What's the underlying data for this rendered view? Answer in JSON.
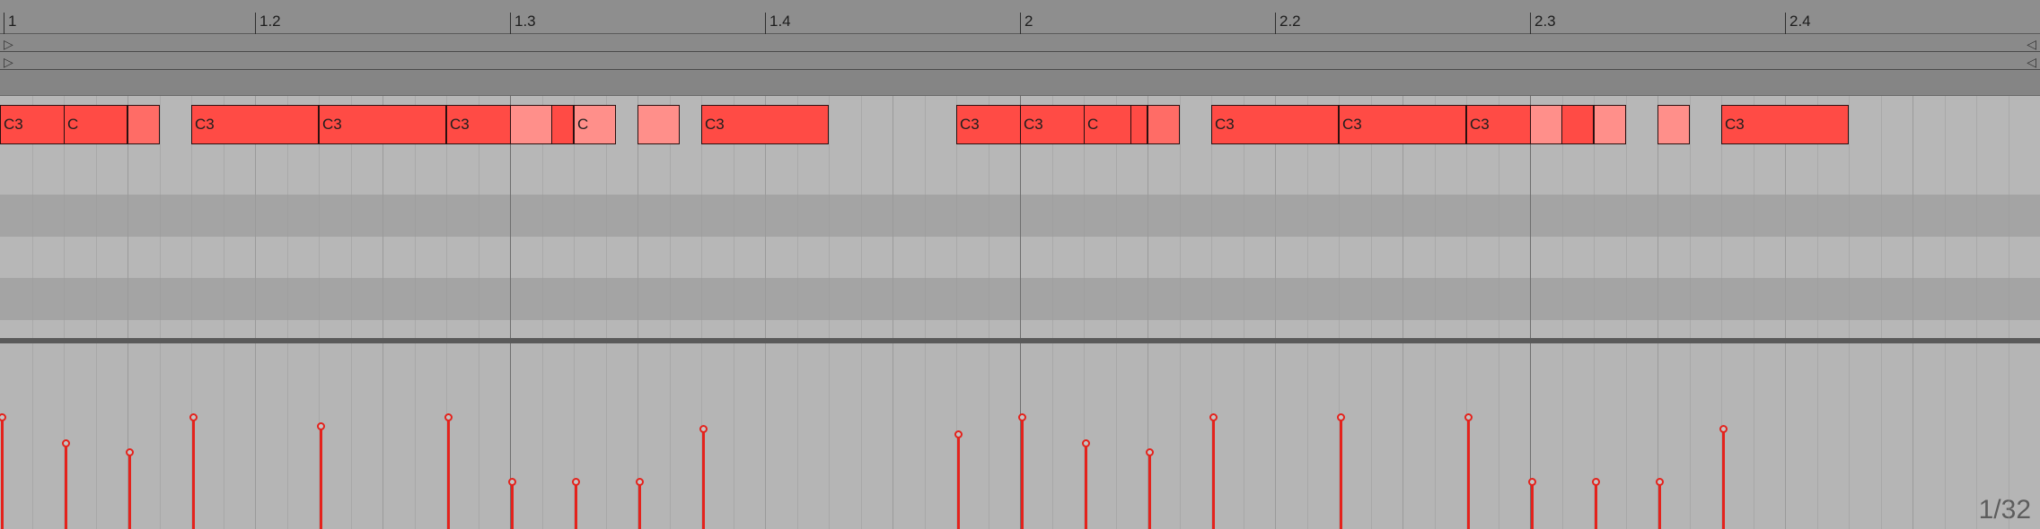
{
  "ruler": {
    "start_beat": 1.0,
    "end_beat": 3.0,
    "markers": [
      {
        "label": "1",
        "beat": 1.0
      },
      {
        "label": "1.2",
        "beat": 1.25
      },
      {
        "label": "1.3",
        "beat": 1.5
      },
      {
        "label": "1.4",
        "beat": 1.75
      },
      {
        "label": "2",
        "beat": 2.0
      },
      {
        "label": "2.2",
        "beat": 2.25
      },
      {
        "label": "2.3",
        "beat": 2.5
      },
      {
        "label": "2.4",
        "beat": 2.75
      }
    ]
  },
  "fold_lanes": [
    {
      "left_glyph": "▷",
      "right_glyph": "◁"
    },
    {
      "left_glyph": "▷",
      "right_glyph": "◁"
    }
  ],
  "notes": [
    {
      "label": "C3",
      "start": 0,
      "length": 2,
      "velocity": 0.78
    },
    {
      "label": "C",
      "start": 2,
      "length": 1,
      "velocity": 0.6
    },
    {
      "label": "",
      "start": 4,
      "length": 0.5,
      "velocity": 0.54
    },
    {
      "label": "C3",
      "start": 6,
      "length": 2,
      "velocity": 0.78
    },
    {
      "label": "C3",
      "start": 10,
      "length": 2,
      "velocity": 0.72
    },
    {
      "label": "C3",
      "start": 14,
      "length": 2,
      "velocity": 0.78
    },
    {
      "label": "",
      "start": 16,
      "length": 0.66,
      "velocity": 0.33
    },
    {
      "label": "C",
      "start": 18,
      "length": 0.66,
      "velocity": 0.33
    },
    {
      "label": "",
      "start": 20,
      "length": 0.66,
      "velocity": 0.33
    },
    {
      "label": "C3",
      "start": 22,
      "length": 2,
      "velocity": 0.7
    },
    {
      "label": "C3",
      "start": 30,
      "length": 2,
      "velocity": 0.66
    },
    {
      "label": "C3",
      "start": 32,
      "length": 2,
      "velocity": 0.78
    },
    {
      "label": "C",
      "start": 34,
      "length": 0.75,
      "velocity": 0.6
    },
    {
      "label": "",
      "start": 36,
      "length": 0.5,
      "velocity": 0.54
    },
    {
      "label": "C3",
      "start": 38,
      "length": 2,
      "velocity": 0.78
    },
    {
      "label": "C3",
      "start": 42,
      "length": 2,
      "velocity": 0.78
    },
    {
      "label": "C3",
      "start": 46,
      "length": 2,
      "velocity": 0.78
    },
    {
      "label": "",
      "start": 48,
      "length": 0.5,
      "velocity": 0.33
    },
    {
      "label": "",
      "start": 50,
      "length": 0.5,
      "velocity": 0.33
    },
    {
      "label": "",
      "start": 52,
      "length": 0.5,
      "velocity": 0.33
    },
    {
      "label": "C3",
      "start": 54,
      "length": 2,
      "velocity": 0.7
    }
  ],
  "grid": {
    "readout": "1/32",
    "divisions_per_beat": 32
  },
  "colors": {
    "note": "#ff4b45",
    "velocity": "#e4221c"
  }
}
